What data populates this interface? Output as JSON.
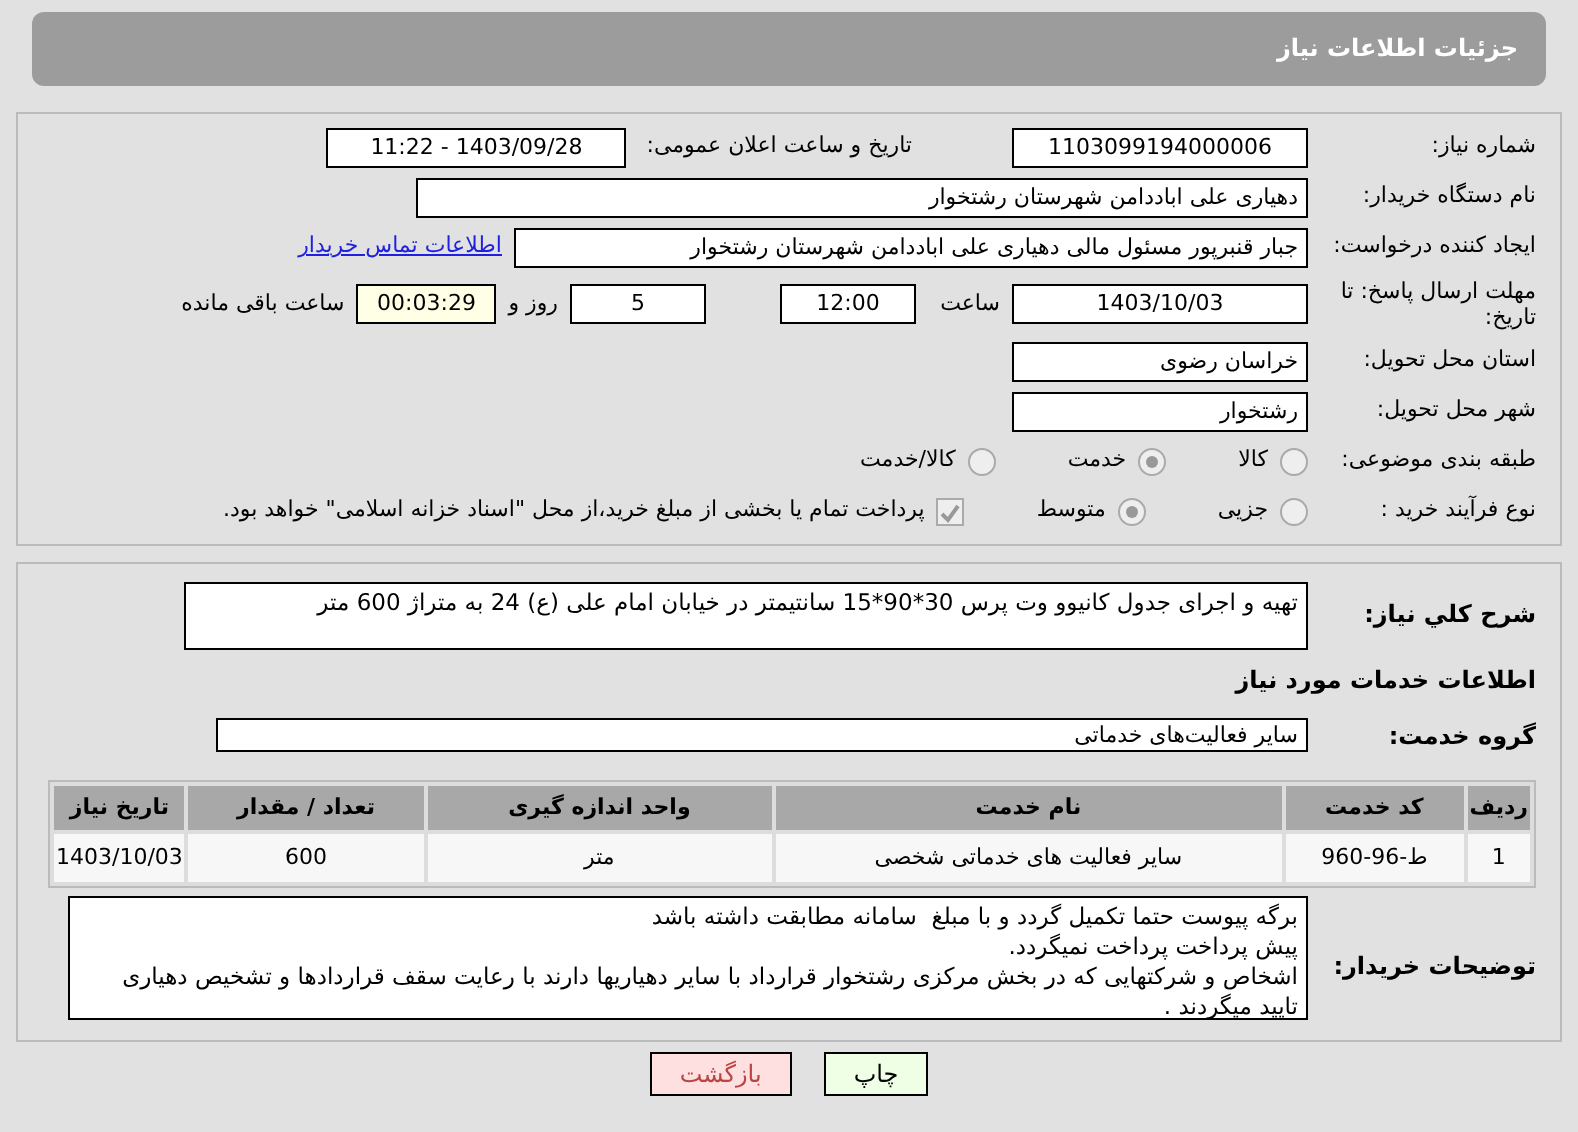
{
  "header": {
    "title": "جزئیات اطلاعات نیاز"
  },
  "need_number": {
    "label": "شماره نیاز:",
    "value": "1103099194000006"
  },
  "announce_date": {
    "label": "تاریخ و ساعت اعلان عمومی:",
    "value": "1403/09/28 - 11:22"
  },
  "buyer_org": {
    "label": "نام دستگاه خریدار:",
    "value": "دهیاری علی اباددامن شهرستان رشتخوار"
  },
  "requester": {
    "label": "ایجاد کننده درخواست:",
    "value": "جبار قنبرپور مسئول مالی دهیاری علی اباددامن شهرستان رشتخوار",
    "link": "اطلاعات تماس خریدار"
  },
  "deadline": {
    "label": "مهلت ارسال پاسخ: تا تاریخ:",
    "date": "1403/10/03",
    "time_label": "ساعت",
    "time": "12:00",
    "days": "5",
    "days_label": "روز و",
    "remaining": "00:03:29",
    "remaining_label": "ساعت باقی مانده"
  },
  "province": {
    "label": "استان محل تحویل:",
    "value": "خراسان رضوی"
  },
  "city": {
    "label": "شهر محل تحویل:",
    "value": "رشتخوار"
  },
  "classification": {
    "label": "طبقه بندی موضوعی:",
    "disabled": true,
    "options": [
      {
        "label": "کالا",
        "selected": false
      },
      {
        "label": "خدمت",
        "selected": true
      },
      {
        "label": "کالا/خدمت",
        "selected": false
      }
    ]
  },
  "purchase_type": {
    "label": "نوع فرآیند خرید :",
    "disabled": true,
    "options": [
      {
        "label": "جزیی",
        "selected": false
      },
      {
        "label": "متوسط",
        "selected": true
      }
    ],
    "payment_check": {
      "checked": true,
      "label": "پرداخت تمام یا بخشی از مبلغ خرید،از محل \"اسناد خزانه اسلامی\" خواهد بود."
    }
  },
  "summary": {
    "label": "شرح کلي نياز:",
    "value": "تهیه و اجرای جدول کانیوو وت پرس 30*90*15 سانتیمتر در خیابان امام علی (ع) 24 به متراژ 600 متر"
  },
  "services_heading": "اطلاعات خدمات مورد نیاز",
  "service_group": {
    "label": "گروه خدمت:",
    "value": "سایر فعالیت‌های خدماتی"
  },
  "table": {
    "columns": [
      "ردیف",
      "کد خدمت",
      "نام خدمت",
      "واحد اندازه گیری",
      "تعداد / مقدار",
      "تاریخ نیاز"
    ],
    "rows": [
      [
        "1",
        "ط-96-960",
        "سایر فعالیت های خدماتی شخصی",
        "متر",
        "600",
        "1403/10/03"
      ]
    ]
  },
  "buyer_notes": {
    "label": "توضیحات خریدار:",
    "lines": [
      "برگه پیوست حتما تکمیل گردد و با مبلغ  سامانه مطابقت داشته باشد",
      "پیش پرداخت پرداخت نمیگردد.",
      "اشخاص و شرکتهایی که در بخش مرکزی رشتخوار قرارداد با سایر دهیاریها دارند با رعایت سقف قراردادها و تشخیص دهیاری تایید میگردند ."
    ]
  },
  "buttons": [
    {
      "label": "چاپ",
      "kind": "print"
    },
    {
      "label": "بازگشت",
      "kind": "back"
    }
  ]
}
